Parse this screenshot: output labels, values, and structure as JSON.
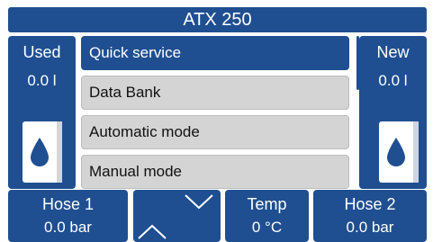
{
  "header": {
    "title": "ATX 250"
  },
  "used_panel": {
    "label": "Used",
    "value": "0.0 l",
    "icon": "oil-tank-icon"
  },
  "new_panel": {
    "label": "New",
    "value": "0.0 l",
    "icon": "oil-tank-icon"
  },
  "menu": {
    "items": [
      {
        "label": "Quick service",
        "selected": true
      },
      {
        "label": "Data Bank"
      },
      {
        "label": "Automatic mode"
      },
      {
        "label": "Manual mode"
      }
    ]
  },
  "status": {
    "hose1": {
      "label": "Hose 1",
      "value": "0.0 bar"
    },
    "temp": {
      "label": "Temp",
      "value": "0 °C"
    },
    "hose2": {
      "label": "Hose 2",
      "value": "0.0 bar"
    }
  },
  "navigation": {
    "up_icon": "chevron-up-icon",
    "down_icon": "chevron-down-icon"
  },
  "colors": {
    "accent": "#1f4f91",
    "menu_item": "#d4d4d4",
    "text_light": "#ffffff"
  }
}
